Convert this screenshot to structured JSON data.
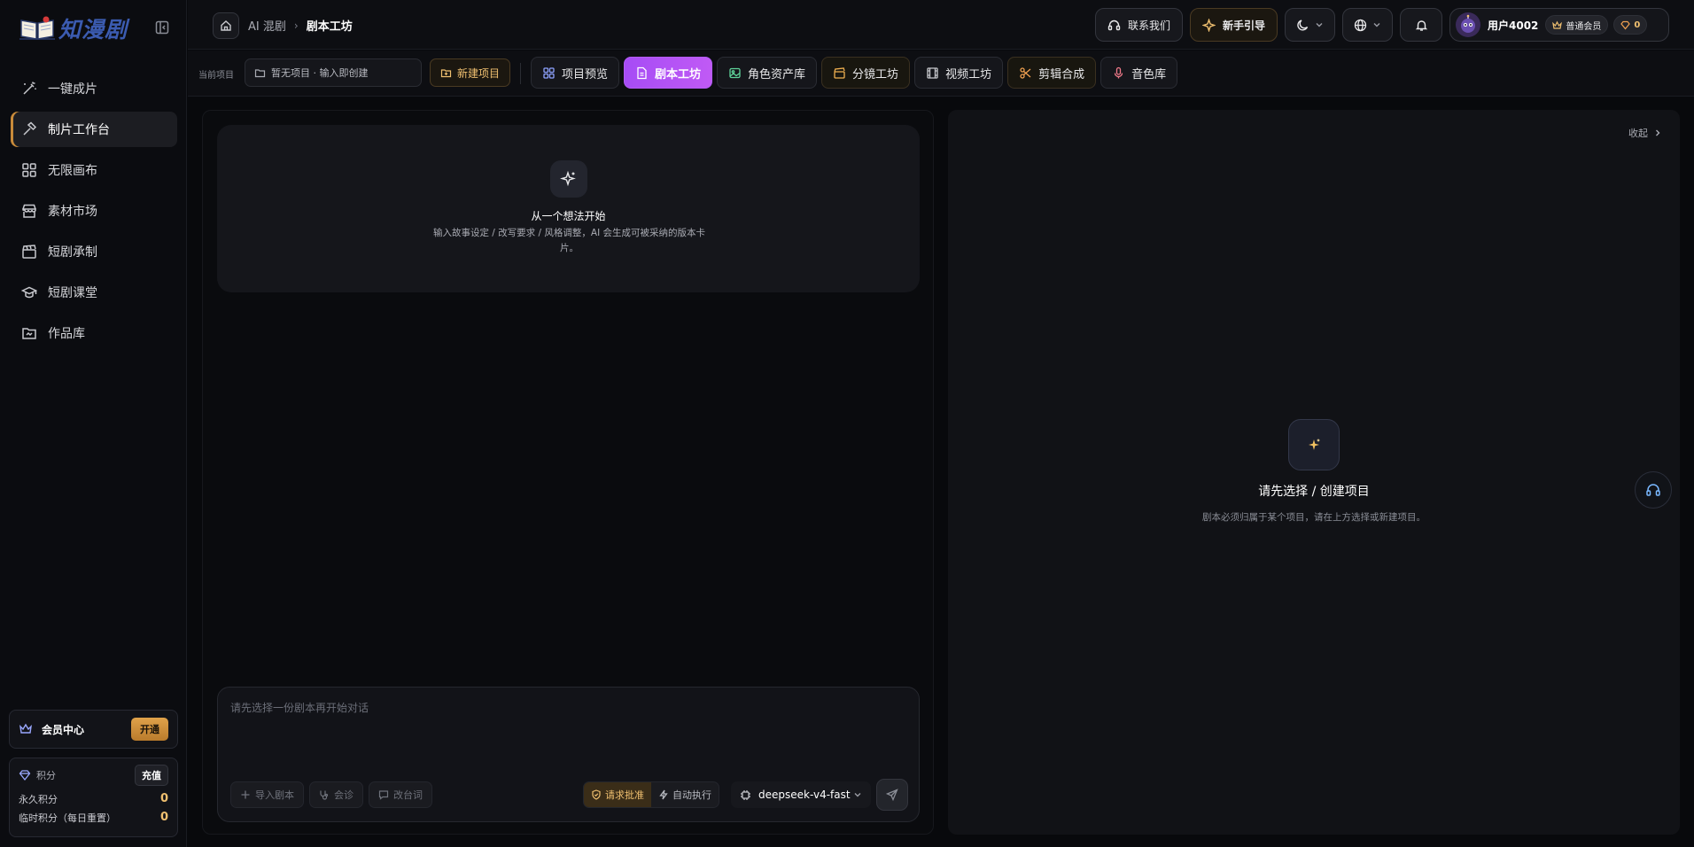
{
  "sidebar": {
    "brand": "知漫剧",
    "items": [
      {
        "label": "一键成片",
        "icon": "magic-wand-icon",
        "active": false
      },
      {
        "label": "制片工作台",
        "icon": "hammer-icon",
        "active": true
      },
      {
        "label": "无限画布",
        "icon": "grid-icon",
        "active": false
      },
      {
        "label": "素材市场",
        "icon": "store-icon",
        "active": false
      },
      {
        "label": "短剧承制",
        "icon": "clapperboard-icon",
        "active": false
      },
      {
        "label": "短剧课堂",
        "icon": "graduation-cap-icon",
        "active": false
      },
      {
        "label": "作品库",
        "icon": "folder-icon",
        "active": false
      }
    ],
    "member": {
      "label": "会员中心",
      "button": "开通"
    },
    "points": {
      "label": "积分",
      "recharge": "充值",
      "permanent_label": "永久积分",
      "permanent_value": "0",
      "temporary_label": "临时积分（每日重置）",
      "temporary_value": "0"
    }
  },
  "header": {
    "breadcrumb": {
      "parent": "AI 混剧",
      "current": "剧本工坊"
    },
    "contact": "联系我们",
    "guide": "新手引导",
    "user": {
      "name": "用户4002",
      "level": "普通会员",
      "gems": "0"
    }
  },
  "toolbar": {
    "current_project_label": "当前项目",
    "project_placeholder": "暂无项目 · 输入即创建",
    "new_project": "新建项目",
    "tabs": [
      {
        "label": "项目预览",
        "icon": "grid-icon",
        "color": "#8ea2ff"
      },
      {
        "label": "剧本工坊",
        "icon": "document-icon",
        "color": "#ffffff"
      },
      {
        "label": "角色资产库",
        "icon": "image-icon",
        "color": "#5fd39a"
      },
      {
        "label": "分镜工坊",
        "icon": "clapperboard-icon",
        "color": "#f0b050"
      },
      {
        "label": "视频工坊",
        "icon": "film-icon",
        "color": "#c7c8cd"
      },
      {
        "label": "剪辑合成",
        "icon": "scissors-icon",
        "color": "#f0a050"
      },
      {
        "label": "音色库",
        "icon": "microphone-icon",
        "color": "#f07a8a"
      }
    ]
  },
  "editor": {
    "idea_title": "从一个想法开始",
    "idea_desc": "输入故事设定 / 改写要求 / 风格调整，AI 会生成可被采纳的版本卡片。",
    "chat_placeholder": "请先选择一份剧本再开始对话",
    "tools": [
      "导入剧本",
      "会诊",
      "改台词"
    ],
    "modes": [
      "请求批准",
      "自动执行"
    ],
    "model": "deepseek-v4-fast"
  },
  "preview": {
    "collapse": "收起",
    "empty_title": "请先选择 / 创建项目",
    "empty_desc": "剧本必须归属于某个项目，请在上方选择或新建项目。"
  },
  "colors": {
    "accent": "#b45cf7",
    "gold": "#f0c070",
    "active_border": "#c98b3a"
  }
}
